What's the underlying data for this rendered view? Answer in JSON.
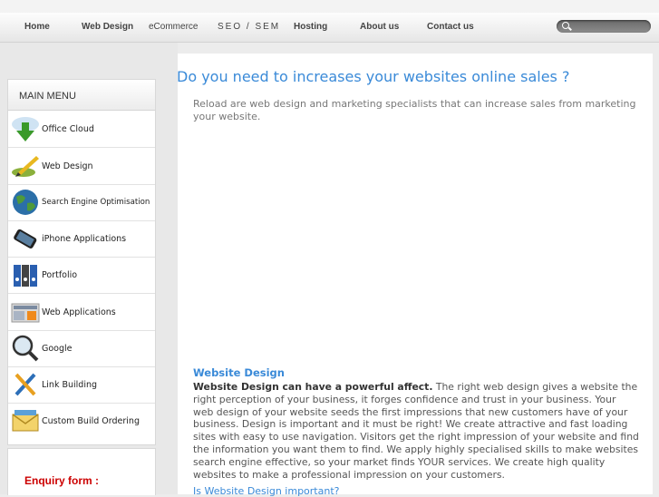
{
  "nav": {
    "items": [
      "Home",
      "Web Design",
      "eCommerce",
      "SEO / SEM",
      "Hosting",
      "About us",
      "Contact us"
    ],
    "search_placeholder": ""
  },
  "sidebar": {
    "title": "MAIN MENU",
    "items": [
      {
        "label": "Office Cloud",
        "icon": "cloud-download-icon"
      },
      {
        "label": "Web Design",
        "icon": "pen-icon"
      },
      {
        "label": "Search Engine Optimisation",
        "icon": "globe-icon"
      },
      {
        "label": "iPhone Applications",
        "icon": "phone-icon"
      },
      {
        "label": "Portfolio",
        "icon": "binders-icon"
      },
      {
        "label": "Web Applications",
        "icon": "news-icon"
      },
      {
        "label": "Google",
        "icon": "magnifier-icon"
      },
      {
        "label": "Link Building",
        "icon": "tools-icon"
      },
      {
        "label": "Custom Build Ordering",
        "icon": "envelope-icon"
      }
    ],
    "enquiry_title": "Enquiry form :"
  },
  "main": {
    "headline": "Do you need to increases your websites online sales ?",
    "intro": "Reload are web design and marketing specialists that can increase sales from marketing your website.",
    "section_title": "Website Design",
    "body_bold": "Website Design can have a powerful affect.",
    "body_text": " The right web design gives a website the right perception of your business, it forges confidence and trust in your business. Your web design of your website seeds the first impressions that new customers have of your business. Design is important and it must be right! We create attractive and fast loading sites with easy to use navigation. Visitors get the right impression of your website and find the information you want them to find. We apply highly specialised skills to make websites search engine effective, so your market finds YOUR services. We create high quality websites to make a professional impression on your customers.",
    "next_title": "Is Website Design important?"
  }
}
